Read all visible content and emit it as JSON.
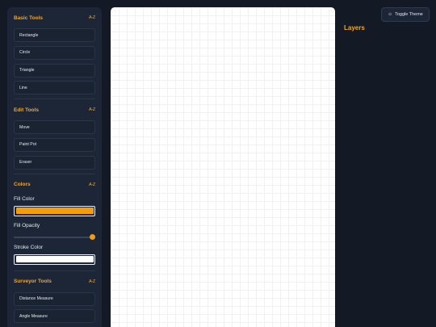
{
  "sidebar": {
    "basic_tools": {
      "title": "Basic Tools",
      "collapse_icon": "A-Z",
      "items": [
        "Rectangle",
        "Circle",
        "Triangle",
        "Line"
      ]
    },
    "edit_tools": {
      "title": "Edit Tools",
      "collapse_icon": "A-Z",
      "items": [
        "Move",
        "Paint Pot",
        "Eraser"
      ]
    },
    "colors": {
      "title": "Colors",
      "collapse_icon": "A-Z",
      "fill_label": "Fill Color",
      "fill_color": "#f59e0b",
      "opacity_label": "Fill Opacity",
      "opacity_value": 1.0,
      "stroke_label": "Stroke Color",
      "stroke_color": "#ffffff"
    },
    "surveyor_tools": {
      "title": "Surveyor Tools",
      "collapse_icon": "A-Z",
      "items": [
        "Distance Measure",
        "Angle Measure"
      ]
    }
  },
  "right_panel": {
    "layers_title": "Layers"
  },
  "toolbar": {
    "toggle_theme_label": "Toggle Theme",
    "toggle_theme_icon": "sun-icon"
  },
  "colors": {
    "accent": "#f5a524",
    "background": "#131a26",
    "panel": "#1c2636"
  }
}
